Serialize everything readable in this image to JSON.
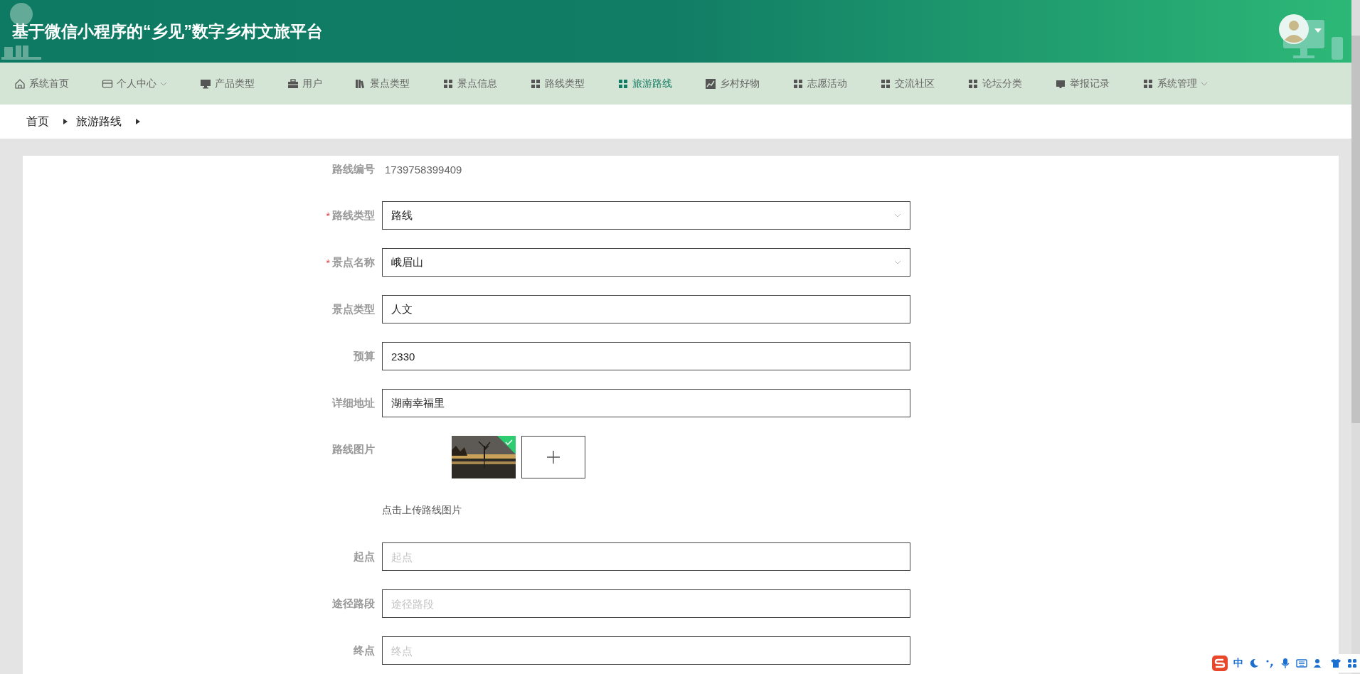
{
  "header": {
    "title": "基于微信小程序的“乡见”数字乡村文旅平台"
  },
  "nav": [
    {
      "label": "系统首页",
      "kind": "home",
      "selected": false,
      "dropdown": false
    },
    {
      "label": "个人中心",
      "kind": "wallet",
      "selected": false,
      "dropdown": true
    },
    {
      "label": "产品类型",
      "kind": "monitor",
      "selected": false,
      "dropdown": false
    },
    {
      "label": "用户",
      "kind": "briefcase",
      "selected": false,
      "dropdown": false
    },
    {
      "label": "景点类型",
      "kind": "books",
      "selected": false,
      "dropdown": false
    },
    {
      "label": "景点信息",
      "kind": "grid",
      "selected": false,
      "dropdown": false
    },
    {
      "label": "路线类型",
      "kind": "grid",
      "selected": false,
      "dropdown": false
    },
    {
      "label": "旅游路线",
      "kind": "grid",
      "selected": true,
      "dropdown": false
    },
    {
      "label": "乡村好物",
      "kind": "chart",
      "selected": false,
      "dropdown": false
    },
    {
      "label": "志愿活动",
      "kind": "grid",
      "selected": false,
      "dropdown": false
    },
    {
      "label": "交流社区",
      "kind": "grid",
      "selected": false,
      "dropdown": false
    },
    {
      "label": "论坛分类",
      "kind": "grid",
      "selected": false,
      "dropdown": false
    },
    {
      "label": "举报记录",
      "kind": "tray",
      "selected": false,
      "dropdown": false
    },
    {
      "label": "系统管理",
      "kind": "grid",
      "selected": false,
      "dropdown": true
    }
  ],
  "breadcrumb": [
    "首页",
    "旅游路线"
  ],
  "form": {
    "rows": [
      {
        "kind": "static",
        "label": "路线编号",
        "value": "1739758399409"
      },
      {
        "kind": "select",
        "label": "路线类型",
        "required_mark": "*",
        "value": "路线"
      },
      {
        "kind": "select",
        "label": "景点名称",
        "required_mark": "*",
        "value": "峨眉山"
      },
      {
        "kind": "text",
        "label": "景点类型",
        "value": "人文"
      },
      {
        "kind": "text",
        "label": "预算",
        "value": "2330"
      },
      {
        "kind": "text",
        "label": "详细地址",
        "value": "湖南幸福里"
      },
      {
        "kind": "upload",
        "label": "路线图片",
        "images": [
          {
            "uploaded": true
          }
        ],
        "hint": "点击上传路线图片"
      },
      {
        "kind": "text",
        "label": "起点",
        "placeholder": "起点"
      },
      {
        "kind": "text",
        "label": "途径路段",
        "placeholder": "途径路段"
      },
      {
        "kind": "text",
        "label": "终点",
        "placeholder": "终点"
      }
    ]
  },
  "ime_toolbar": {
    "mode": "中"
  }
}
